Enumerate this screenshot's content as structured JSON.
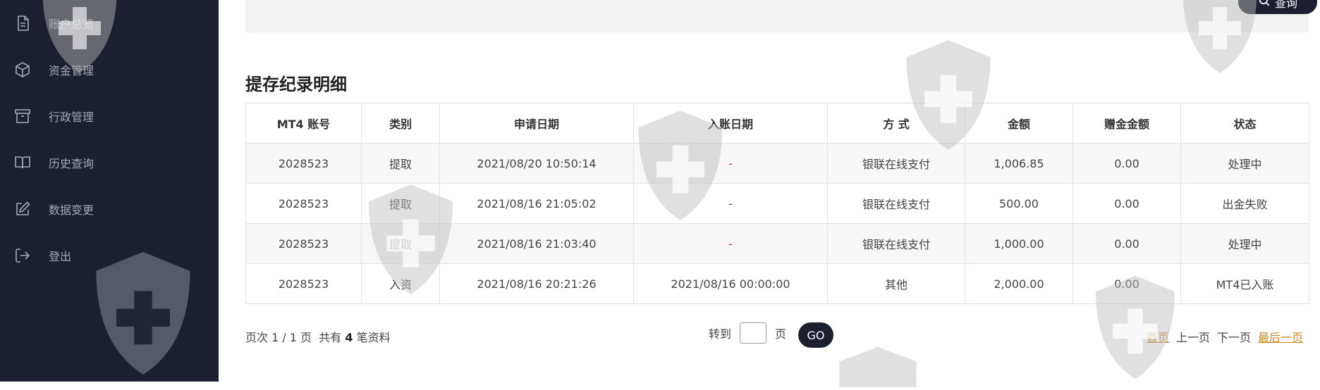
{
  "sidebar": {
    "items": [
      {
        "label": "账户总览",
        "icon": "document-icon"
      },
      {
        "label": "资金管理",
        "icon": "cube-icon"
      },
      {
        "label": "行政管理",
        "icon": "archive-box-icon"
      },
      {
        "label": "历史查询",
        "icon": "open-book-icon"
      },
      {
        "label": "数据变更",
        "icon": "edit-icon"
      },
      {
        "label": "登出",
        "icon": "logout-icon"
      }
    ]
  },
  "search": {
    "button_label": "查询"
  },
  "section": {
    "title": "提存纪录明细"
  },
  "table": {
    "headers": [
      "MT4 账号",
      "类别",
      "申请日期",
      "入账日期",
      "方 式",
      "金额",
      "赠金金额",
      "状态"
    ],
    "rows": [
      [
        "2028523",
        "提取",
        "2021/08/20 10:50:14",
        "-",
        "银联在线支付",
        "1,006.85",
        "0.00",
        "处理中"
      ],
      [
        "2028523",
        "提取",
        "2021/08/16 21:05:02",
        "-",
        "银联在线支付",
        "500.00",
        "0.00",
        "出金失败"
      ],
      [
        "2028523",
        "提取",
        "2021/08/16 21:03:40",
        "-",
        "银联在线支付",
        "1,000.00",
        "0.00",
        "处理中"
      ],
      [
        "2028523",
        "入资",
        "2021/08/16 20:21:26",
        "2021/08/16 00:00:00",
        "其他",
        "2,000.00",
        "0.00",
        "MT4已入账"
      ]
    ]
  },
  "pagination": {
    "page_prefix": "页次 ",
    "page_info": "1 / 1",
    "page_suffix": " 页",
    "total_prefix": "共有 ",
    "total_count": "4",
    "total_suffix": " 笔资料",
    "goto_label": "转到",
    "goto_suffix": "页",
    "go_label": "GO",
    "first": "首页",
    "prev": "上一页",
    "next": "下一页",
    "last": "最后一页"
  },
  "colors": {
    "sidebar_bg": "#1c1f2f",
    "accent_link": "#c9862a",
    "dash_red": "#c0392b"
  }
}
